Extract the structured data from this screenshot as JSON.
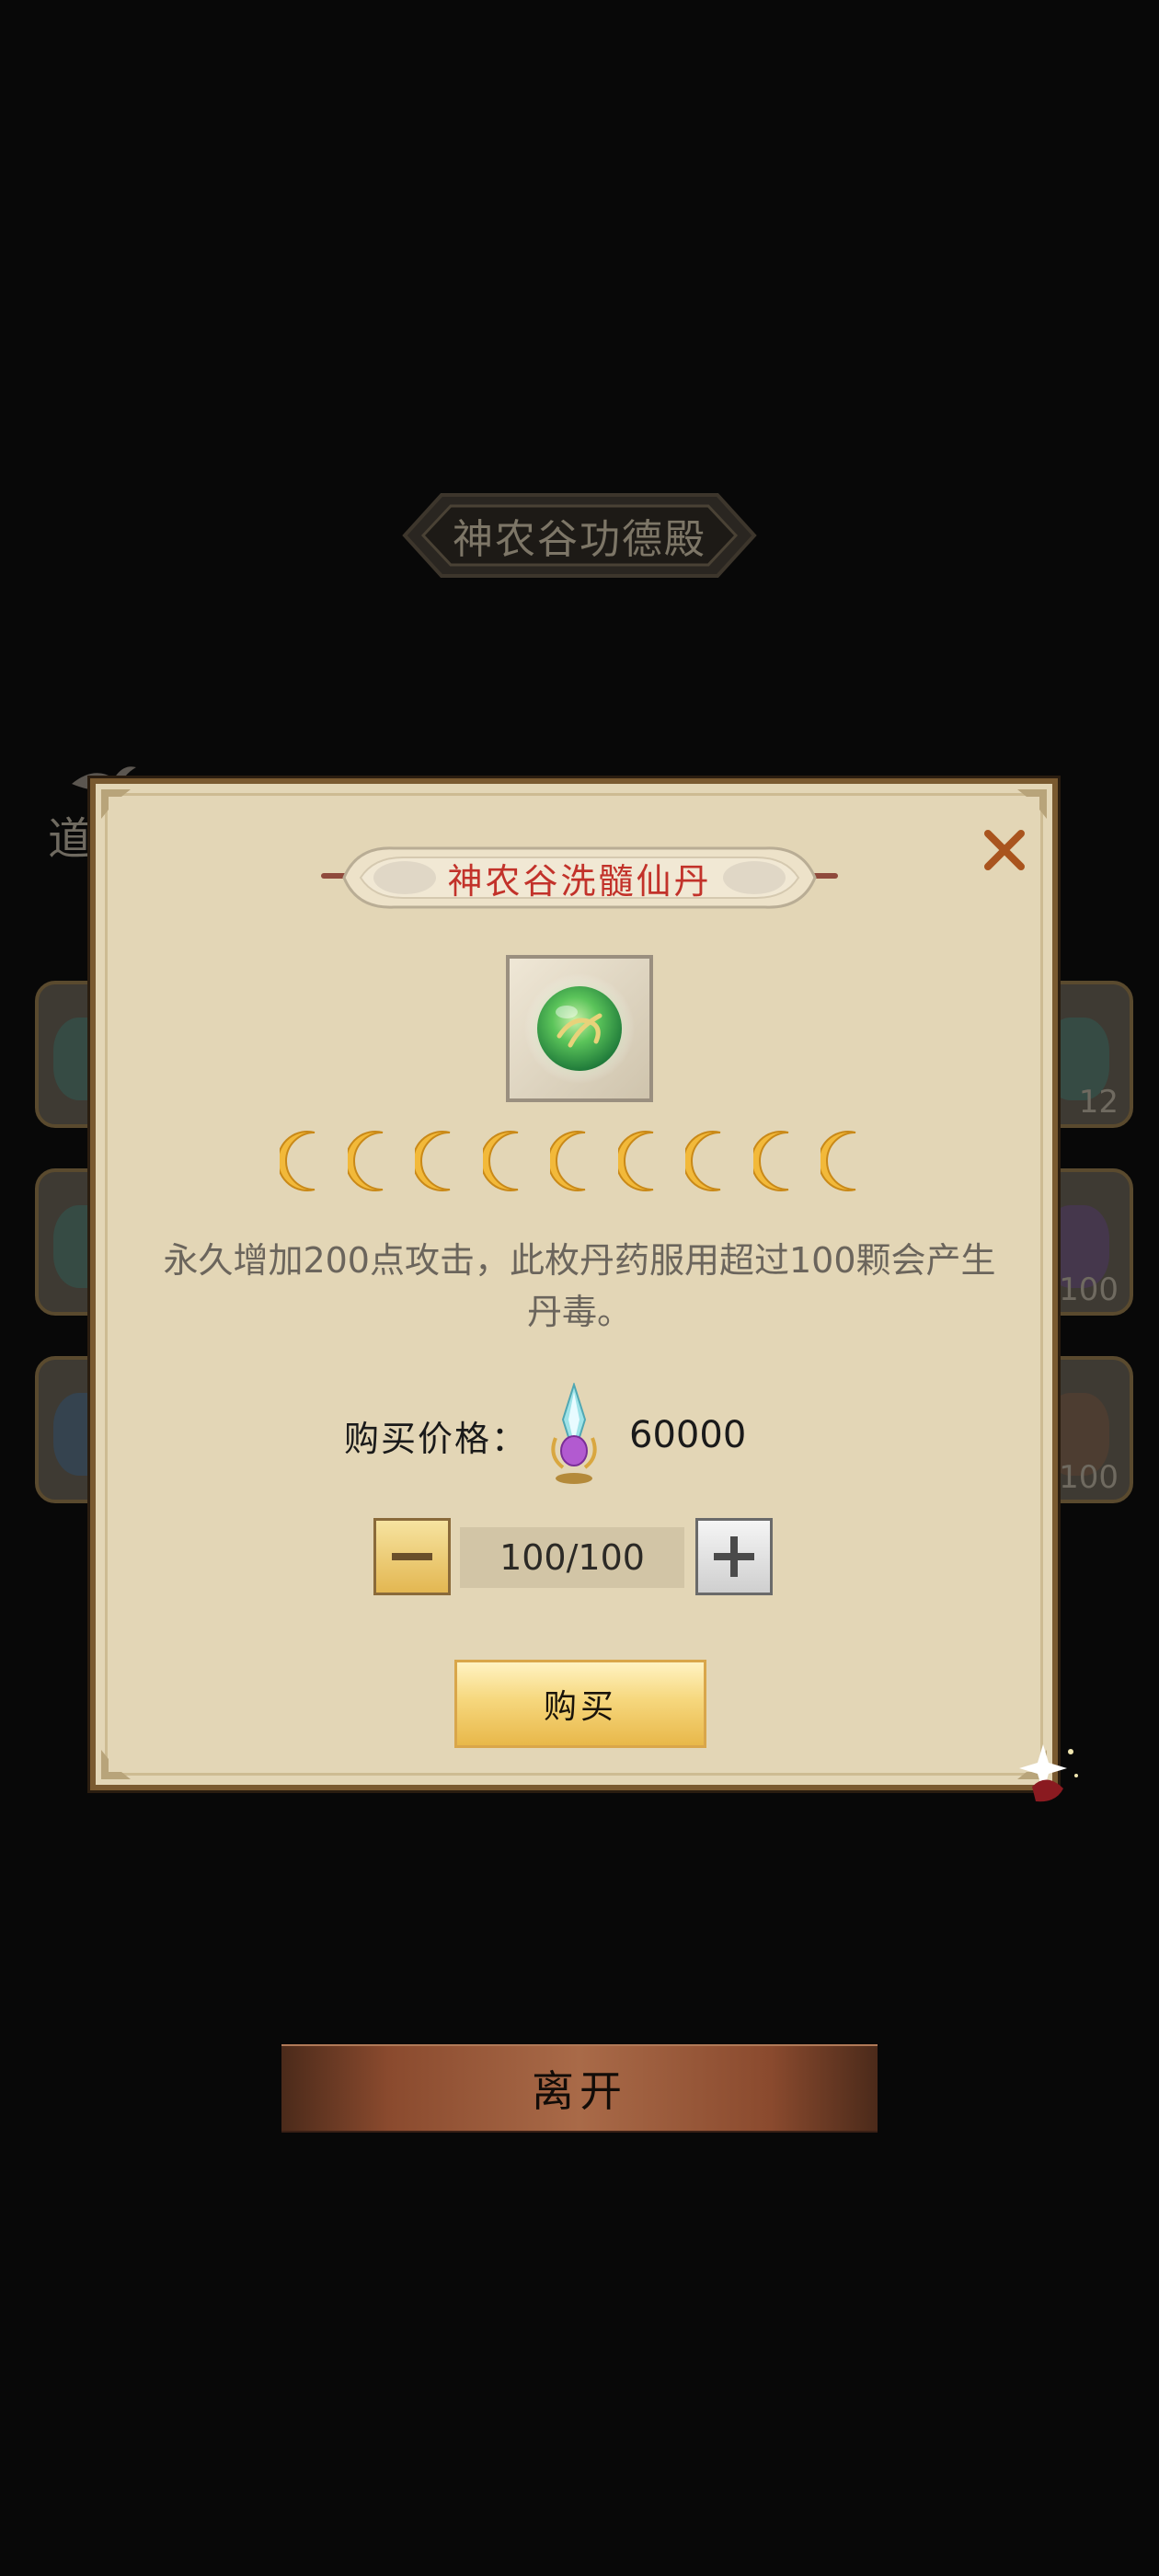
{
  "background": {
    "title": "神农谷功德殿",
    "tab_label_partial": "道",
    "right_slot_counts": [
      "12",
      "100",
      "100"
    ],
    "leave_button": "离开"
  },
  "dialog": {
    "title": "神农谷洗髓仙丹",
    "item_icon": "green-elixir-pill-icon",
    "star_rating": {
      "icon": "crescent-moon-icon",
      "count": 9
    },
    "description": "永久增加200点攻击，此枚丹药服用超过100颗会产生丹毒。",
    "price": {
      "label": "购买价格：",
      "currency_icon": "jade-crystal-icon",
      "value": "60000"
    },
    "quantity": {
      "value": "100/100"
    },
    "buy_button": "购买"
  },
  "colors": {
    "dialog_title": "#c2322a",
    "dialog_bg": "#e3d6b6",
    "buy_button_gold": "#f6d77d",
    "leave_button_copper": "#a96a48"
  }
}
